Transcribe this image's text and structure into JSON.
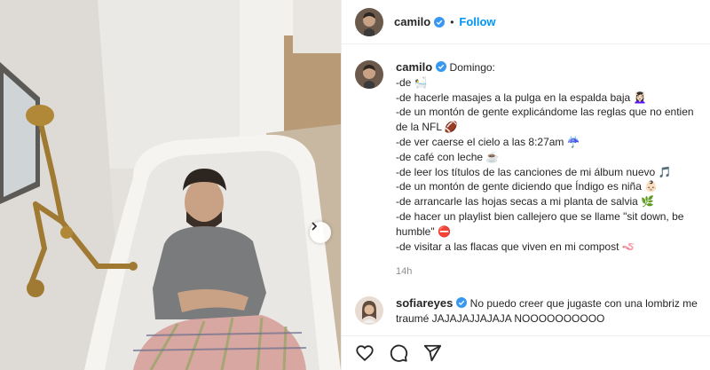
{
  "post": {
    "author": "camilo",
    "follow_label": "Follow",
    "dot": "•"
  },
  "caption": {
    "author": "camilo",
    "title": "Domingo:",
    "lines": [
      "-de 🛀",
      "-de hacerle masajes a la pulga en la espalda baja 💆🏻‍♀️",
      "-de un montón de gente explicándome las reglas que no entien",
      "de la NFL 🏈",
      "-de ver caerse el cielo a las 8:27am ☔",
      "-de café con leche ☕",
      "-de leer los títulos de las canciones de mi álbum nuevo 🎵",
      "-de un montón de gente diciendo que Índigo es niña 👶🏻",
      "-de arrancarle las hojas secas a mi planta de salvia 🌿",
      "-de hacer un playlist bien callejero que se llame \"sit down, be",
      "humble\" ⛔",
      "-de visitar a las flacas que viven en mi compost 🪱"
    ],
    "time": "14h"
  },
  "comment": {
    "author": "sofiareyes",
    "line1": "No puedo creer que jugaste con una lombriz me",
    "line2": "traumé JAJAJAJJAJAJA NOOOOOOOOOO"
  },
  "icons": {
    "like": "heart-icon",
    "comment": "comment-icon",
    "share": "share-icon",
    "verified": "verified-badge-icon",
    "next": "chevron-right-icon"
  },
  "colors": {
    "link": "#0095f6",
    "verified": "#3897f0",
    "muted": "#8e8e8e",
    "text": "#262626"
  }
}
